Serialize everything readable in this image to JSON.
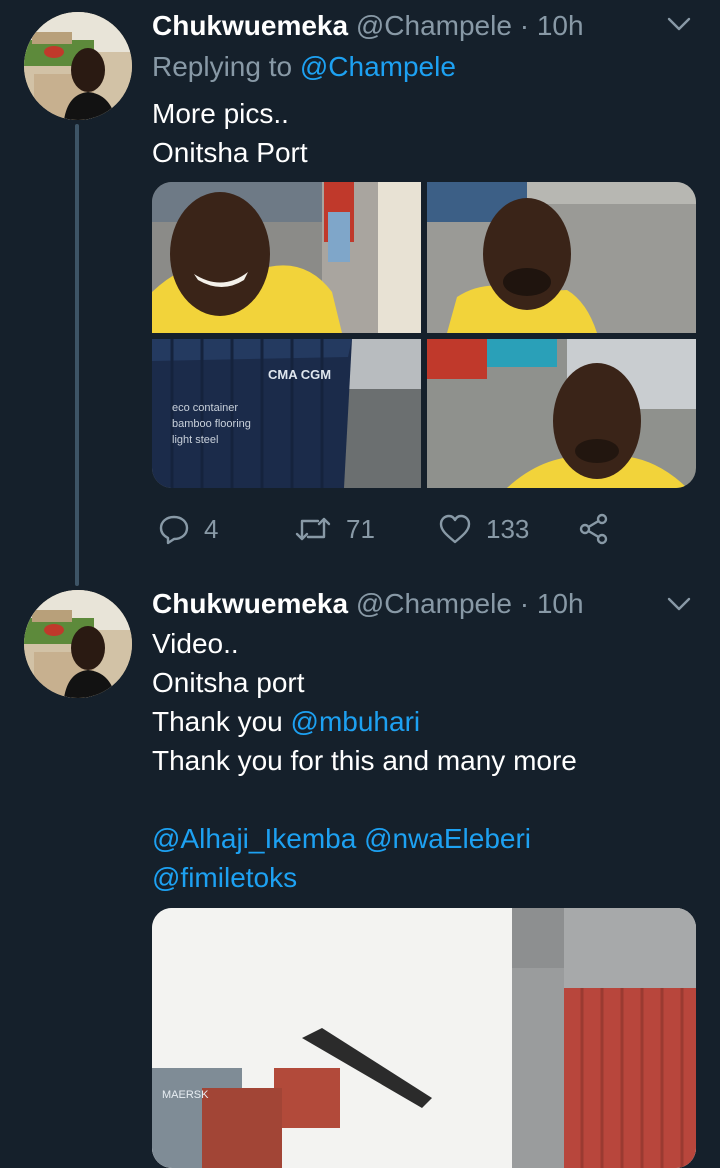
{
  "tweets": [
    {
      "name": "Chukwuemeka",
      "handle": "@Champele",
      "sep": "·",
      "time": "10h",
      "replying_prefix": "Replying to",
      "replying_handle": "@Champele",
      "lines": [
        "More pics..",
        "Onitsha Port"
      ],
      "photos": [
        "selfie-smiling-yellow-shirt",
        "selfie-bald-yellow-shirt",
        "cma-cgm-container-yard",
        "selfie-closeup-port"
      ],
      "container_text": [
        "CMA CGM",
        "eco container",
        "bamboo flooring",
        "light steel"
      ],
      "stats": {
        "replies": "4",
        "retweets": "71",
        "likes": "133"
      },
      "icons": [
        "reply-icon",
        "retweet-icon",
        "like-icon",
        "share-icon",
        "chevron-down-icon"
      ]
    },
    {
      "name": "Chukwuemeka",
      "handle": "@Champele",
      "sep": "·",
      "time": "10h",
      "line1": "Video..",
      "line2": "Onitsha port",
      "line3_text": "Thank you ",
      "line3_mention": "@mbuhari",
      "line4": "Thank you for this and many more",
      "mentions_row1": "@Alhaji_Ikemba @nwaEleberi",
      "mentions_row2": "@fimiletoks",
      "media": "port-crane-video-thumbnail",
      "container_text": "MAERSK"
    }
  ],
  "colors": {
    "background": "#15202b",
    "text": "#ffffff",
    "secondary": "#8899a6",
    "accent": "#1da1f2",
    "thread_line": "#3d5466"
  }
}
